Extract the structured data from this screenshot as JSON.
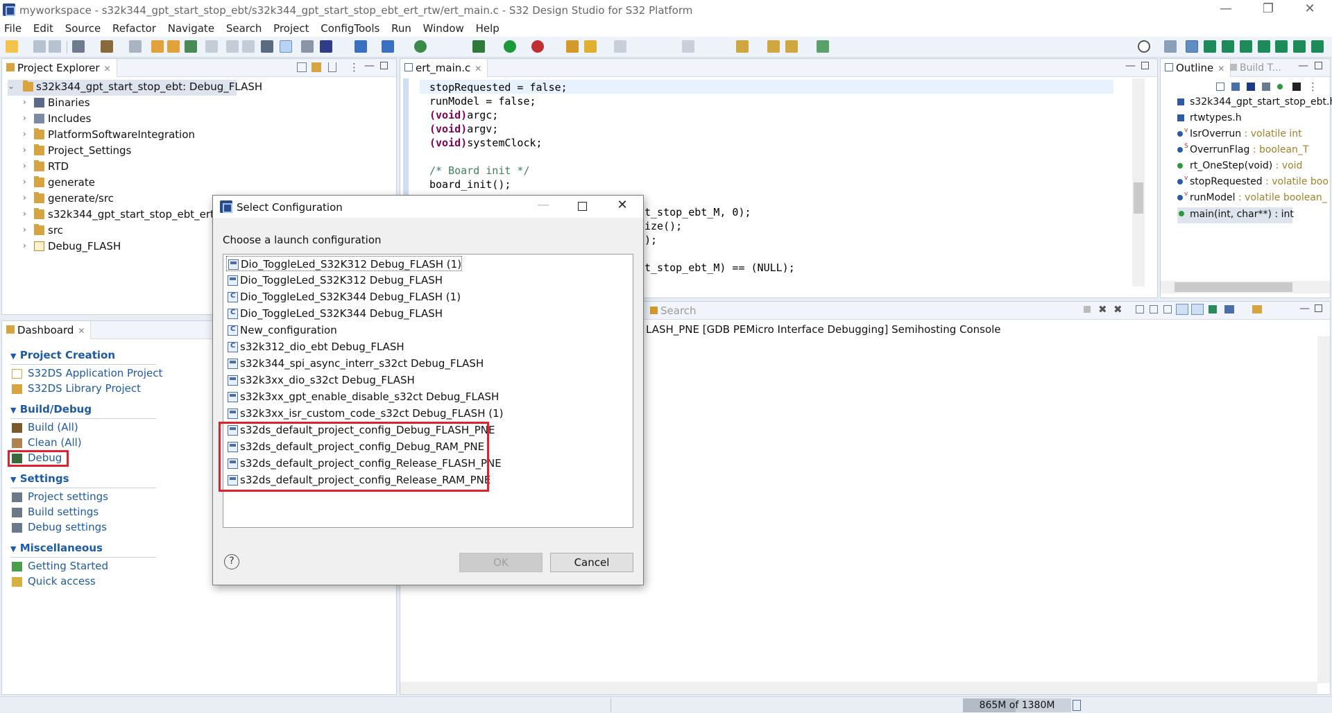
{
  "window": {
    "title": "myworkspace - s32k344_gpt_start_stop_ebt/s32k344_gpt_start_stop_ebt_ert_rtw/ert_main.c - S32 Design Studio for S32 Platform",
    "minimize": "—",
    "restore": "❐",
    "close": "✕"
  },
  "menu": [
    "File",
    "Edit",
    "Source",
    "Refactor",
    "Navigate",
    "Search",
    "Project",
    "ConfigTools",
    "Run",
    "Window",
    "Help"
  ],
  "project_explorer": {
    "tab": "Project Explorer",
    "root": "s32k344_gpt_start_stop_ebt: Debug_FLASH",
    "items": [
      "Binaries",
      "Includes",
      "PlatformSoftwareIntegration",
      "Project_Settings",
      "RTD",
      "generate",
      "generate/src",
      "s32k344_gpt_start_stop_ebt_ert_rtw",
      "src",
      "Debug_FLASH"
    ]
  },
  "dashboard": {
    "tab": "Dashboard",
    "sections": [
      {
        "title": "Project Creation",
        "items": [
          "S32DS Application Project",
          "S32DS Library Project"
        ]
      },
      {
        "title": "Build/Debug",
        "items": [
          "Build  (All)",
          "Clean  (All)",
          "Debug"
        ]
      },
      {
        "title": "Settings",
        "items": [
          "Project settings",
          "Build settings",
          "Debug settings"
        ]
      },
      {
        "title": "Miscellaneous",
        "items": [
          "Getting Started",
          "Quick access"
        ]
      }
    ]
  },
  "editor": {
    "tab": "ert_main.c",
    "lines": {
      "l1": "stopRequested = false;",
      "l2a": "runModel = false;",
      "l3_kw": "(void)",
      "l3": "argc;",
      "l4_kw": "(void)",
      "l4": "argv;",
      "l5_kw": "(void)",
      "l5": "systemClock;",
      "l7": "/* Board init */",
      "l8": "board_init();",
      "l10": "t_stop_ebt_M, 0);",
      "l11": "ize();",
      "l12": ");",
      "l14": "t_stop_ebt_M) == (NULL);"
    }
  },
  "outline": {
    "tab": "Outline",
    "tab2": "Build T...",
    "rows": [
      {
        "name": "s32k344_gpt_start_stop_ebt.h",
        "type": ""
      },
      {
        "name": "rtwtypes.h",
        "type": ""
      },
      {
        "name": "IsrOverrun",
        "type": " : volatile int",
        "sup": "v"
      },
      {
        "name": "OverrunFlag",
        "type": " : boolean_T",
        "sup": "S"
      },
      {
        "name": "rt_OneStep(void)",
        "type": " : void"
      },
      {
        "name": "stopRequested",
        "type": " : volatile boo",
        "sup": "v"
      },
      {
        "name": "runModel",
        "type": " : volatile boolean_",
        "sup": "v"
      },
      {
        "name": "main(int, char**) : int",
        "type": ""
      }
    ]
  },
  "console": {
    "search_tab": "Search",
    "title": "LASH_PNE [GDB PEMicro Interface Debugging] Semihosting Console"
  },
  "status": {
    "memory": "865M of 1380M"
  },
  "dialog": {
    "title": "Select Configuration",
    "prompt": "Choose a launch configuration",
    "items": [
      "Dio_ToggleLed_S32K312 Debug_FLASH (1)",
      "Dio_ToggleLed_S32K312 Debug_FLASH",
      "Dio_ToggleLed_S32K344 Debug_FLASH (1)",
      "Dio_ToggleLed_S32K344 Debug_FLASH",
      "New_configuration",
      "s32k312_dio_ebt Debug_FLASH",
      "s32k344_spi_async_interr_s32ct Debug_FLASH",
      "s32k3xx_dio_s32ct Debug_FLASH",
      "s32k3xx_gpt_enable_disable_s32ct Debug_FLASH",
      "s32k3xx_isr_custom_code_s32ct Debug_FLASH (1)",
      "s32ds_default_project_config_Debug_FLASH_PNE",
      "s32ds_default_project_config_Debug_RAM_PNE",
      "s32ds_default_project_config_Release_FLASH_PNE",
      "s32ds_default_project_config_Release_RAM_PNE"
    ],
    "ok": "OK",
    "cancel": "Cancel",
    "help": "?"
  },
  "colors": {
    "accent": "#1d5aa8",
    "highlight": "#e0202e",
    "brand": "#2b4a8a"
  }
}
